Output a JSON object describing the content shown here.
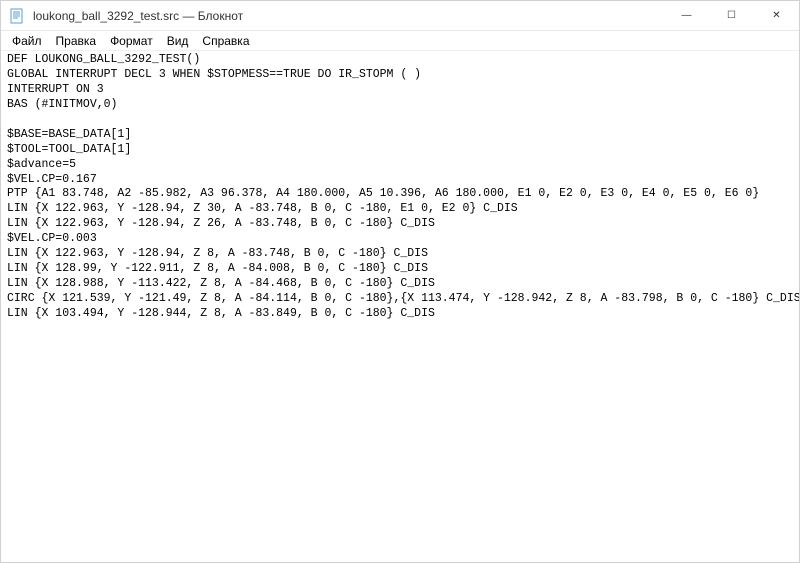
{
  "window": {
    "title": "loukong_ball_3292_test.src — Блокнот",
    "icon_name": "notepad-icon"
  },
  "controls": {
    "minimize": "—",
    "maximize": "☐",
    "close": "✕"
  },
  "menu": {
    "file": "Файл",
    "edit": "Правка",
    "format": "Формат",
    "view": "Вид",
    "help": "Справка"
  },
  "document": {
    "text": "DEF LOUKONG_BALL_3292_TEST()\nGLOBAL INTERRUPT DECL 3 WHEN $STOPMESS==TRUE DO IR_STOPM ( )\nINTERRUPT ON 3\nBAS (#INITMOV,0)\n\n$BASE=BASE_DATA[1]\n$TOOL=TOOL_DATA[1]\n$advance=5\n$VEL.CP=0.167\nPTP {A1 83.748, A2 -85.982, A3 96.378, A4 180.000, A5 10.396, A6 180.000, E1 0, E2 0, E3 0, E4 0, E5 0, E6 0}\nLIN {X 122.963, Y -128.94, Z 30, A -83.748, B 0, C -180, E1 0, E2 0} C_DIS\nLIN {X 122.963, Y -128.94, Z 26, A -83.748, B 0, C -180} C_DIS\n$VEL.CP=0.003\nLIN {X 122.963, Y -128.94, Z 8, A -83.748, B 0, C -180} C_DIS\nLIN {X 128.99, Y -122.911, Z 8, A -84.008, B 0, C -180} C_DIS\nLIN {X 128.988, Y -113.422, Z 8, A -84.468, B 0, C -180} C_DIS\nCIRC {X 121.539, Y -121.49, Z 8, A -84.114, B 0, C -180},{X 113.474, Y -128.942, Z 8, A -83.798, B 0, C -180} C_DIS\nLIN {X 103.494, Y -128.944, Z 8, A -83.849, B 0, C -180} C_DIS"
  }
}
